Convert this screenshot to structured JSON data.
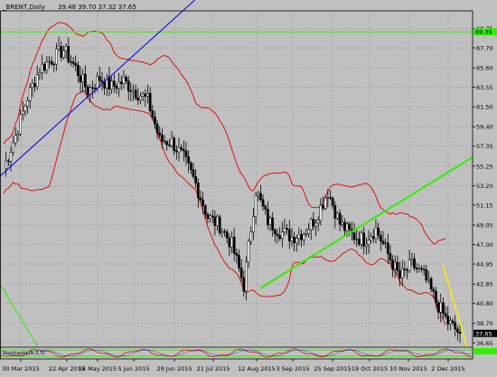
{
  "header": {
    "symbol": "_BRENT,Daily",
    "ohlc": "39.48 39.70 37.32 37.65"
  },
  "colors": {
    "background": "#c0c0c0",
    "grid": "#9c9c9c",
    "axis": "#000000",
    "candle_up": "#000000",
    "candle_down": "#000000",
    "bollinger": "#e00000",
    "trendline_blue": "#0000e0",
    "trendline_green": "#33ee00",
    "trendline_yellow": "#ffee00",
    "price_label_green": "#33ee00",
    "price_label_black": "#000000"
  },
  "chart_data": {
    "type": "candlestick",
    "instrument": "BRENT",
    "timeframe": "Daily",
    "grid": true,
    "y_axis": {
      "position": "right",
      "range": [
        36.2,
        71.6
      ],
      "ticks": [
        "69.75",
        "67.70",
        "65.60",
        "63.55",
        "61.50",
        "59.40",
        "57.35",
        "55.25",
        "53.20",
        "51.15",
        "49.05",
        "47.00",
        "44.95",
        "42.85",
        "40.80",
        "38.70",
        "36.65"
      ]
    },
    "x_axis": {
      "ticks": [
        "30 Mar 2015",
        "22 Apr 2015",
        "14 May 2015",
        "5 Jun 2015",
        "29 Jun 2015",
        "21 Jul 2015",
        "12 Aug 2015",
        "3 Sep 2015",
        "25 Sep 2015",
        "19 Oct 2015",
        "10 Nov 2015",
        "2 Dec 2015"
      ]
    },
    "price_labels": [
      {
        "value": "69.39",
        "style": "green"
      },
      {
        "value": "37.65",
        "style": "black"
      }
    ],
    "horizontal_lines": [
      {
        "value": 69.39,
        "color": "green"
      }
    ],
    "series_close_points": [
      {
        "x": "30 Mar 2015",
        "y": 55.0
      },
      {
        "x": "8 Apr 2015",
        "y": 58.5
      },
      {
        "x": "15 Apr 2015",
        "y": 62.5
      },
      {
        "x": "22 Apr 2015",
        "y": 65.5
      },
      {
        "x": "1 May 2015",
        "y": 66.5
      },
      {
        "x": "6 May 2015",
        "y": 67.5
      },
      {
        "x": "14 May 2015",
        "y": 65.6
      },
      {
        "x": "22 May 2015",
        "y": 63.2
      },
      {
        "x": "29 May 2015",
        "y": 64.5
      },
      {
        "x": "5 Jun 2015",
        "y": 63.6
      },
      {
        "x": "12 Jun 2015",
        "y": 64.2
      },
      {
        "x": "19 Jun 2015",
        "y": 63.1
      },
      {
        "x": "29 Jun 2015",
        "y": 62.2
      },
      {
        "x": "6 Jul 2015",
        "y": 58.0
      },
      {
        "x": "13 Jul 2015",
        "y": 57.8
      },
      {
        "x": "21 Jul 2015",
        "y": 56.1
      },
      {
        "x": "28 Jul 2015",
        "y": 53.4
      },
      {
        "x": "5 Aug 2015",
        "y": 49.9
      },
      {
        "x": "12 Aug 2015",
        "y": 49.0
      },
      {
        "x": "19 Aug 2015",
        "y": 47.0
      },
      {
        "x": "24 Aug 2015",
        "y": 42.7
      },
      {
        "x": "31 Aug 2015",
        "y": 52.7
      },
      {
        "x": "3 Sep 2015",
        "y": 49.5
      },
      {
        "x": "10 Sep 2015",
        "y": 48.4
      },
      {
        "x": "18 Sep 2015",
        "y": 47.8
      },
      {
        "x": "25 Sep 2015",
        "y": 48.3
      },
      {
        "x": "2 Oct 2015",
        "y": 49.8
      },
      {
        "x": "9 Oct 2015",
        "y": 52.6
      },
      {
        "x": "14 Oct 2015",
        "y": 49.2
      },
      {
        "x": "19 Oct 2015",
        "y": 48.0
      },
      {
        "x": "26 Oct 2015",
        "y": 47.5
      },
      {
        "x": "2 Nov 2015",
        "y": 48.6
      },
      {
        "x": "10 Nov 2015",
        "y": 46.0
      },
      {
        "x": "17 Nov 2015",
        "y": 43.5
      },
      {
        "x": "24 Nov 2015",
        "y": 44.9
      },
      {
        "x": "2 Dec 2015",
        "y": 43.7
      },
      {
        "x": "7 Dec 2015",
        "y": 41.0
      },
      {
        "x": "11 Dec 2015",
        "y": 38.8
      },
      {
        "x": "14 Dec 2015",
        "y": 37.65
      }
    ]
  },
  "indicator_panel": {
    "label": "Stochastic(5,3,3)"
  }
}
